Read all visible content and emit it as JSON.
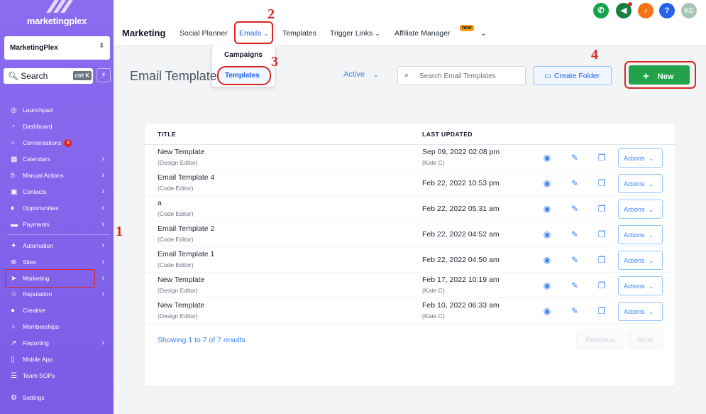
{
  "sidebar": {
    "logo_text": "marketingplex",
    "account": "MarketingPlex",
    "search_label": "Search",
    "search_shortcut": "ctrl K",
    "items": [
      {
        "label": "Launchpad",
        "icon": "rocket-icon"
      },
      {
        "label": "Dashboard",
        "icon": "gauge-icon"
      },
      {
        "label": "Conversations",
        "icon": "chat-icon",
        "badge": "3"
      },
      {
        "label": "Calendars",
        "icon": "calendar-icon"
      },
      {
        "label": "Manual Actions",
        "icon": "hand-icon"
      },
      {
        "label": "Contacts",
        "icon": "contact-card-icon"
      },
      {
        "label": "Opportunities",
        "icon": "flame-icon"
      },
      {
        "label": "Payments",
        "icon": "card-icon"
      },
      {
        "label": "Automation",
        "icon": "wand-icon"
      },
      {
        "label": "Sites",
        "icon": "globe-icon"
      },
      {
        "label": "Marketing",
        "icon": "send-icon"
      },
      {
        "label": "Reputation",
        "icon": "star-icon"
      },
      {
        "label": "Creative",
        "icon": "palette-icon"
      },
      {
        "label": "Memberships",
        "icon": "badge-icon"
      },
      {
        "label": "Reporting",
        "icon": "chart-icon"
      },
      {
        "label": "Mobile App",
        "icon": "phone-icon"
      },
      {
        "label": "Team SOPs",
        "icon": "list-icon"
      },
      {
        "label": "Settings",
        "icon": "gear-icon"
      }
    ]
  },
  "topbar": {
    "title": "Marketing",
    "links": [
      "Social Planner",
      "Emails",
      "Templates",
      "Trigger Links",
      "Affiliate Manager"
    ],
    "new_badge": "new",
    "avatar_initials": "KC"
  },
  "emails_dropdown": {
    "options": [
      "Campaigns",
      "Templates"
    ]
  },
  "annotations": [
    "1",
    "2",
    "3",
    "4"
  ],
  "page": {
    "title": "Email Template",
    "status": "Active",
    "search_placeholder": "Search Email Templates",
    "create_folder": "Create Folder",
    "new_button": "New"
  },
  "table": {
    "headers": [
      "TITLE",
      "LAST UPDATED"
    ],
    "rows": [
      {
        "name": "New Template",
        "editor": "(Design Editor)",
        "date": "Sep 09, 2022 02:08 pm",
        "by": "(Kate C)"
      },
      {
        "name": "Email Template 4",
        "editor": "(Code Editor)",
        "date": "Feb 22, 2022 10:53 pm",
        "by": ""
      },
      {
        "name": "a",
        "editor": "(Code Editor)",
        "date": "Feb 22, 2022 05:31 am",
        "by": ""
      },
      {
        "name": "Email Template 2",
        "editor": "(Code Editor)",
        "date": "Feb 22, 2022 04:52 am",
        "by": ""
      },
      {
        "name": "Email Template 1",
        "editor": "(Code Editor)",
        "date": "Feb 22, 2022 04:50 am",
        "by": ""
      },
      {
        "name": "New Template",
        "editor": "(Design Editor)",
        "date": "Feb 17, 2022 10:19 am",
        "by": "(Kate C)"
      },
      {
        "name": "New Template",
        "editor": "(Design Editor)",
        "date": "Feb 10, 2022 06:33 am",
        "by": "(Kate C)"
      }
    ],
    "actions_label": "Actions",
    "showing": "Showing 1 to 7 of 7 results",
    "previous": "Previous",
    "next": "Next"
  },
  "colors": {
    "sidebar": "#8b6cf0",
    "accent": "#3b82f6",
    "new_button": "#22a34a",
    "annotation": "#dc2626"
  }
}
